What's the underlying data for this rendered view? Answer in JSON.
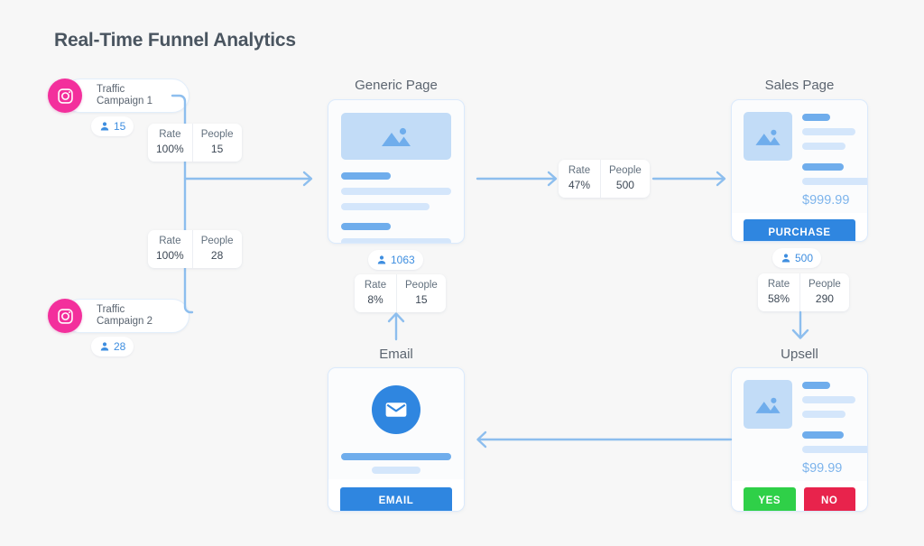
{
  "title": "Real-Time Funnel Analytics",
  "colors": {
    "background": "#f7f7f7",
    "accent_blue": "#2f86e0",
    "connector_blue": "#8dbeee",
    "instagram_pink": "#f32f9c",
    "yes_green": "#2fd048",
    "no_red": "#e8234c",
    "price_blue": "#7db4ec",
    "title_gray": "#4a5560"
  },
  "traffic_sources": [
    {
      "icon": "instagram-icon",
      "label": "Traffic\nCampaign 1",
      "people_icon": "person-icon",
      "people_count": "15"
    },
    {
      "icon": "instagram-icon",
      "label": "Traffic\nCampaign 2",
      "people_icon": "person-icon",
      "people_count": "28"
    }
  ],
  "metrics": [
    {
      "id": "campaign1-to-generic",
      "rate_header": "Rate",
      "rate_value": "100%",
      "people_header": "People",
      "people_value": "15"
    },
    {
      "id": "campaign2-to-generic",
      "rate_header": "Rate",
      "rate_value": "100%",
      "people_header": "People",
      "people_value": "28"
    },
    {
      "id": "generic-to-sales",
      "rate_header": "Rate",
      "rate_value": "47%",
      "people_header": "People",
      "people_value": "500"
    },
    {
      "id": "email-to-generic",
      "rate_header": "Rate",
      "rate_value": "8%",
      "people_header": "People",
      "people_value": "15"
    },
    {
      "id": "sales-to-upsell",
      "rate_header": "Rate",
      "rate_value": "58%",
      "people_header": "People",
      "people_value": "290"
    }
  ],
  "nodes": {
    "generic_page": {
      "caption": "Generic Page",
      "people_icon": "person-icon",
      "people_count": "1063",
      "image_icon": "image-placeholder-icon"
    },
    "sales_page": {
      "caption": "Sales Page",
      "price": "$999.99",
      "button_label": "PURCHASE",
      "people_icon": "person-icon",
      "people_count": "500",
      "image_icon": "image-placeholder-icon"
    },
    "upsell": {
      "caption": "Upsell",
      "price": "$99.99",
      "yes_label": "YES",
      "no_label": "NO",
      "image_icon": "image-placeholder-icon"
    },
    "email": {
      "caption": "Email",
      "button_label": "EMAIL",
      "mail_icon": "envelope-icon"
    }
  },
  "connectors": [
    {
      "name": "campaigns-to-generic",
      "direction": "right"
    },
    {
      "name": "generic-to-metric",
      "direction": "right"
    },
    {
      "name": "metric-to-sales",
      "direction": "right"
    },
    {
      "name": "sales-to-upsell",
      "direction": "down"
    },
    {
      "name": "upsell-to-email",
      "direction": "left"
    },
    {
      "name": "email-to-generic",
      "direction": "up"
    }
  ]
}
